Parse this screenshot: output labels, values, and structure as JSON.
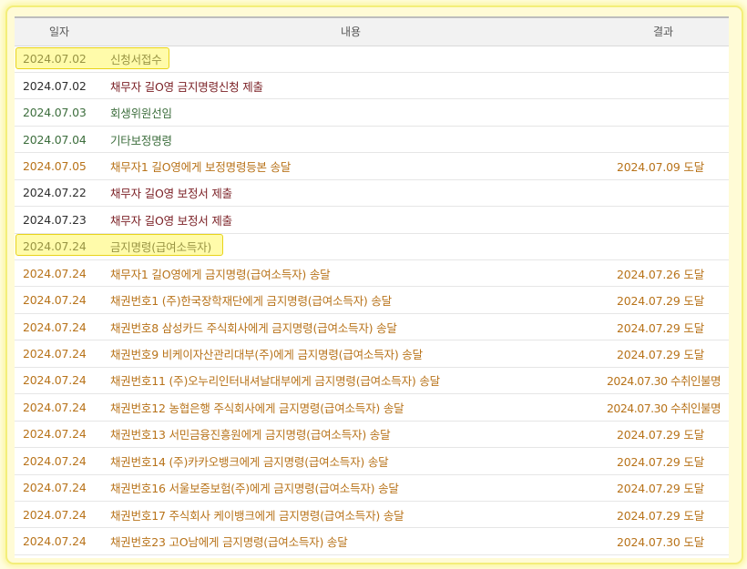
{
  "header": {
    "date": "일자",
    "content": "내용",
    "result": "결과"
  },
  "rows": [
    {
      "date": "2024.07.02",
      "content": "신청서접수",
      "result": ""
    },
    {
      "date": "2024.07.02",
      "content": "채무자 길O영 금지명령신청 제출",
      "result": ""
    },
    {
      "date": "2024.07.03",
      "content": "회생위원선임",
      "result": ""
    },
    {
      "date": "2024.07.04",
      "content": "기타보정명령",
      "result": ""
    },
    {
      "date": "2024.07.05",
      "content": "채무자1 길O영에게 보정명령등본 송달",
      "result": "2024.07.09 도달"
    },
    {
      "date": "2024.07.22",
      "content": "채무자 길O영 보정서 제출",
      "result": ""
    },
    {
      "date": "2024.07.23",
      "content": "채무자 길O영 보정서 제출",
      "result": ""
    },
    {
      "date": "2024.07.24",
      "content": "금지명령(급여소득자)",
      "result": ""
    },
    {
      "date": "2024.07.24",
      "content": "채무자1 길O영에게 금지명령(급여소득자) 송달",
      "result": "2024.07.26 도달"
    },
    {
      "date": "2024.07.24",
      "content": "채권번호1 (주)한국장학재단에게 금지명령(급여소득자) 송달",
      "result": "2024.07.29 도달"
    },
    {
      "date": "2024.07.24",
      "content": "채권번호8 삼성카드 주식회사에게 금지명령(급여소득자) 송달",
      "result": "2024.07.29 도달"
    },
    {
      "date": "2024.07.24",
      "content": "채권번호9 비케이자산관리대부(주)에게 금지명령(급여소득자) 송달",
      "result": "2024.07.29 도달"
    },
    {
      "date": "2024.07.24",
      "content": "채권번호11 (주)오누리인터내셔날대부에게 금지명령(급여소득자) 송달",
      "result": "2024.07.30 수취인불명"
    },
    {
      "date": "2024.07.24",
      "content": "채권번호12 농협은행 주식회사에게 금지명령(급여소득자) 송달",
      "result": "2024.07.30 수취인불명"
    },
    {
      "date": "2024.07.24",
      "content": "채권번호13 서민금융진흥원에게 금지명령(급여소득자) 송달",
      "result": "2024.07.29 도달"
    },
    {
      "date": "2024.07.24",
      "content": "채권번호14 (주)카카오뱅크에게 금지명령(급여소득자) 송달",
      "result": "2024.07.29 도달"
    },
    {
      "date": "2024.07.24",
      "content": "채권번호16 서울보증보험(주)에게 금지명령(급여소득자) 송달",
      "result": "2024.07.29 도달"
    },
    {
      "date": "2024.07.24",
      "content": "채권번호17 주식회사 케이뱅크에게 금지명령(급여소득자) 송달",
      "result": "2024.07.29 도달"
    },
    {
      "date": "2024.07.24",
      "content": "채권번호23 고O남에게 금지명령(급여소득자) 송달",
      "result": "2024.07.30 도달"
    }
  ],
  "colors": {
    "dark_red": "#7a1f24",
    "green": "#3d6e3d",
    "orange": "#b8731a",
    "highlight": "#fff764"
  }
}
